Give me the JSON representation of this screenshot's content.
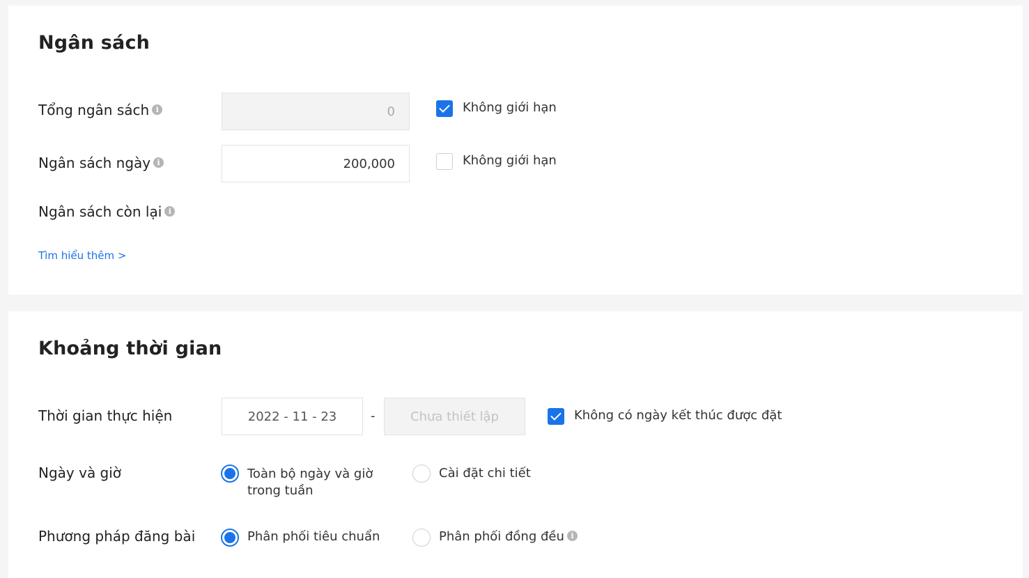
{
  "budget": {
    "title": "Ngân sách",
    "total": {
      "label": "Tổng ngân sách",
      "value": "0",
      "unlimited_label": "Không giới hạn",
      "unlimited_checked": true
    },
    "daily": {
      "label": "Ngân sách ngày",
      "value": "200,000",
      "unlimited_label": "Không giới hạn",
      "unlimited_checked": false
    },
    "remaining": {
      "label": "Ngân sách còn lại"
    },
    "learn_more": "Tìm hiểu thêm >"
  },
  "period": {
    "title": "Khoảng thời gian",
    "run_time": {
      "label": "Thời gian thực hiện",
      "start_date": "2022 - 11 - 23",
      "separator": "-",
      "end_placeholder": "Chưa thiết lập",
      "no_end_label": "Không có ngày kết thúc được đặt",
      "no_end_checked": true
    },
    "day_time": {
      "label": "Ngày và giờ",
      "options": [
        "Toàn bộ ngày và giờ trong tuần",
        "Cài đặt chi tiết"
      ],
      "selected": 0
    },
    "posting_method": {
      "label": "Phương pháp đăng bài",
      "options": [
        "Phân phối tiêu chuẩn",
        "Phân phối đồng đều"
      ],
      "selected": 0
    }
  },
  "icons": {
    "info": "info-icon",
    "checkbox": "checkbox-check-icon"
  },
  "colors": {
    "accent": "#1a73e8",
    "background": "#f5f5f5",
    "card": "#ffffff",
    "disabled_input": "#f3f3f3",
    "info_icon": "#b5b5b5"
  }
}
